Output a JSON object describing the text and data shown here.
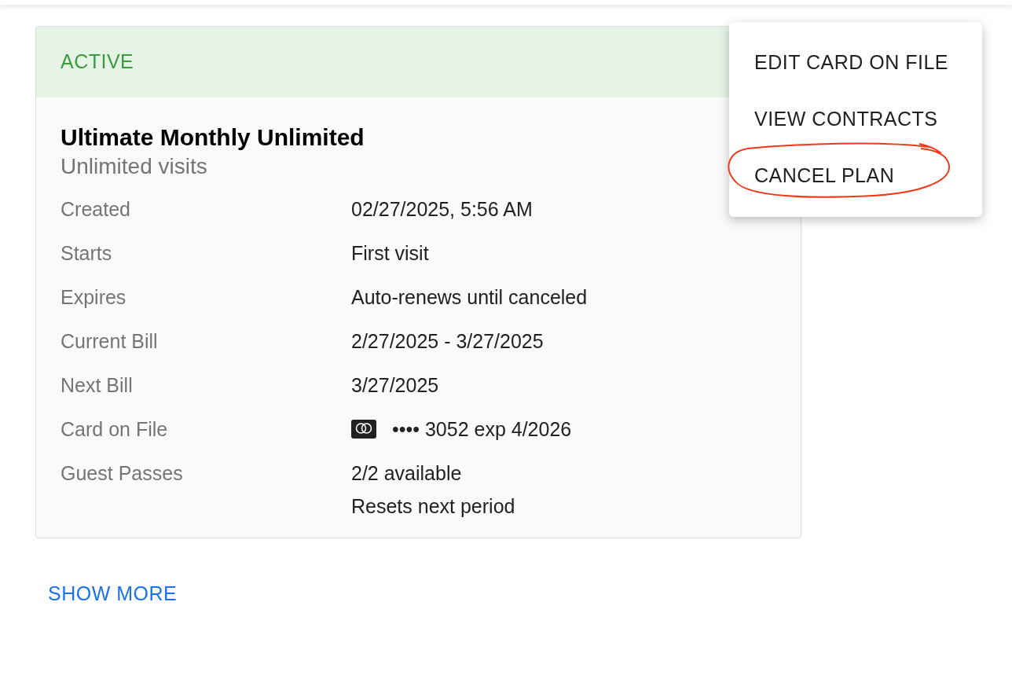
{
  "plan": {
    "status": "ACTIVE",
    "title": "Ultimate Monthly Unlimited",
    "subtitle": "Unlimited visits",
    "rows": [
      {
        "label": "Created",
        "value": "02/27/2025, 5:56 AM"
      },
      {
        "label": "Starts",
        "value": "First visit"
      },
      {
        "label": "Expires",
        "value": "Auto-renews until canceled"
      },
      {
        "label": "Current Bill",
        "value": "2/27/2025 - 3/27/2025"
      },
      {
        "label": "Next Bill",
        "value": "3/27/2025"
      },
      {
        "label": "Card on File",
        "kind": "card",
        "value": "•••• 3052 exp 4/2026"
      },
      {
        "label": "Guest Passes",
        "value": "2/2 available",
        "note": "Resets next period"
      }
    ]
  },
  "show_more": "SHOW MORE",
  "menu": [
    {
      "label": "EDIT CARD ON FILE",
      "circled": false
    },
    {
      "label": "VIEW CONTRACTS",
      "circled": false
    },
    {
      "label": "CANCEL PLAN",
      "circled": true
    }
  ]
}
